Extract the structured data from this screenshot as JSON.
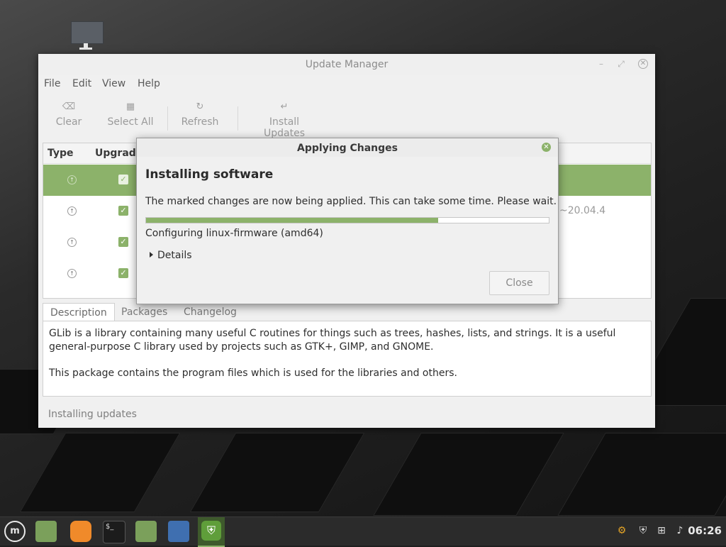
{
  "window": {
    "title": "Update Manager",
    "controls": {
      "minimize": "–",
      "maximize": "⤢",
      "close": "✕"
    }
  },
  "menu": [
    "File",
    "Edit",
    "View",
    "Help"
  ],
  "toolbar": {
    "clear": "Clear",
    "select_all": "Select All",
    "refresh": "Refresh",
    "install_updates": "Install Updates"
  },
  "list": {
    "columns": {
      "type": "Type",
      "upgrade": "Upgrade"
    },
    "rows": [
      {
        "selected": true,
        "version": ""
      },
      {
        "selected": false,
        "version": "~20.04.4"
      },
      {
        "selected": false,
        "version": ""
      },
      {
        "selected": false,
        "version": ""
      }
    ]
  },
  "tabs": [
    "Description",
    "Packages",
    "Changelog"
  ],
  "description": {
    "para1": "GLib is a library containing many useful C routines for things such as trees, hashes, lists, and strings.  It is a useful general-purpose C library used by projects such as GTK+, GIMP, and GNOME.",
    "para2": "This package contains the program files which is used for the libraries and others."
  },
  "status": "Installing updates",
  "dialog": {
    "title": "Applying Changes",
    "heading": "Installing software",
    "message": "The marked changes are now being applied. This can take some time. Please wait.",
    "progress": 0.725,
    "status": "Configuring linux-firmware (amd64)",
    "details": "Details",
    "close": "Close"
  },
  "taskbar": {
    "clock": "06:26",
    "items": [
      "mint-menu-icon",
      "files-icon",
      "firefox-icon",
      "terminal-icon",
      "folder-icon",
      "screenshot-icon",
      "update-manager-icon"
    ]
  },
  "colors": {
    "accent": "#8cb26a",
    "panel": "#2b2b2b"
  }
}
